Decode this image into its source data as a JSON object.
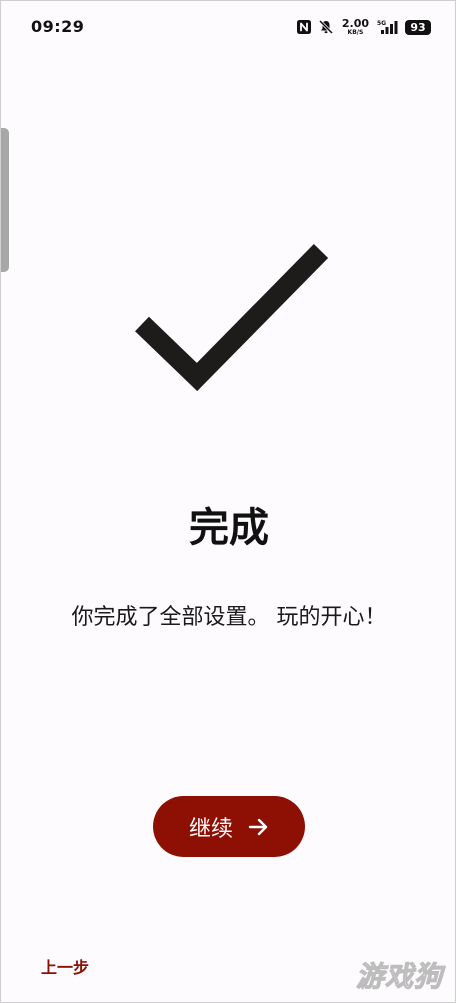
{
  "status_bar": {
    "time": "09:29",
    "net_speed_value": "2.00",
    "net_speed_unit": "KB/S",
    "network_type": "5G",
    "battery_level": "93",
    "icons": [
      "nfc-icon",
      "bell-off-icon",
      "signal-icon",
      "battery-icon"
    ]
  },
  "main": {
    "icon": "checkmark-icon",
    "title": "完成",
    "message": "你完成了全部设置。 玩的开心！"
  },
  "actions": {
    "continue_label": "继续",
    "continue_icon": "arrow-right-icon",
    "back_label": "上一步"
  },
  "watermark": {
    "text": "游戏狗"
  },
  "colors": {
    "accent": "#8e0f04",
    "background": "#fdfbfd",
    "text": "#1a1a1a"
  }
}
